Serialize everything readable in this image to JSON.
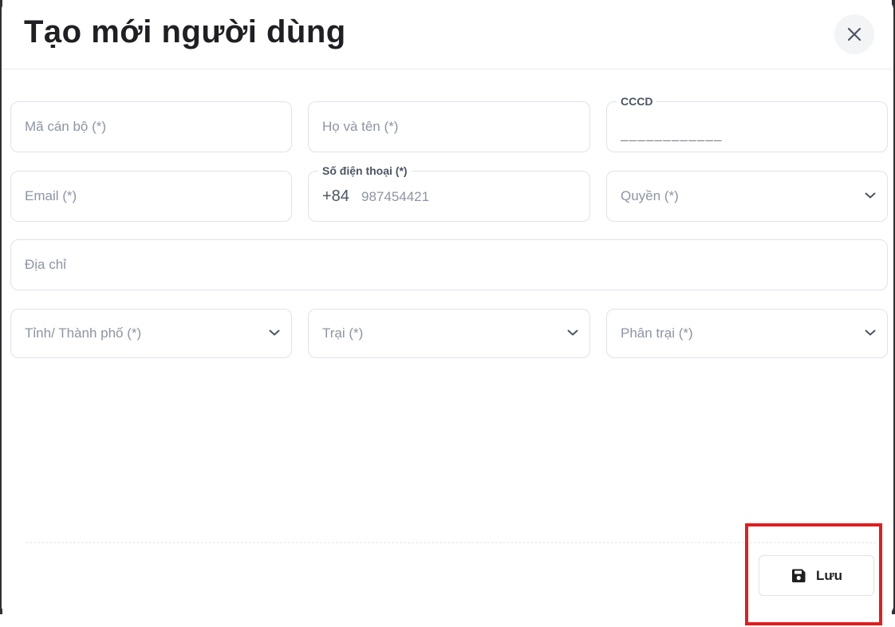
{
  "dialog": {
    "title": "Tạo mới người dùng"
  },
  "form": {
    "staff_code": {
      "placeholder": "Mã cán bộ (*)"
    },
    "full_name": {
      "placeholder": "Họ và tên (*)"
    },
    "id_card": {
      "label": "CCCD",
      "value": "____________"
    },
    "email": {
      "placeholder": "Email (*)"
    },
    "phone": {
      "label": "Số điện thoại (*)",
      "prefix": "+84",
      "placeholder": "987454421"
    },
    "role": {
      "placeholder": "Quyền (*)"
    },
    "address": {
      "placeholder": "Địa chỉ"
    },
    "province": {
      "placeholder": "Tỉnh/ Thành phố (*)"
    },
    "camp": {
      "placeholder": "Trại (*)"
    },
    "sub_camp": {
      "placeholder": "Phân trại (*)"
    }
  },
  "footer": {
    "save_label": "Lưu"
  },
  "colors": {
    "highlight": "#e11d1d",
    "border": "#dfe3e8",
    "placeholder": "#8c95a3"
  }
}
